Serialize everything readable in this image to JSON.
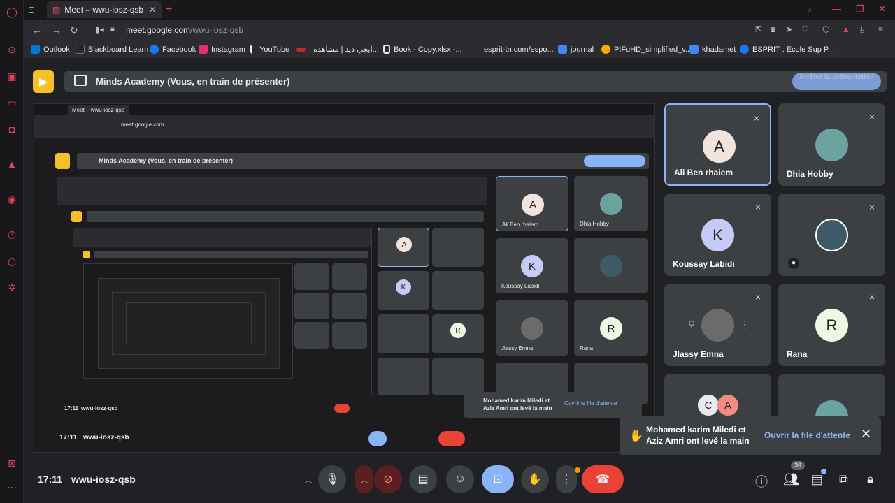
{
  "browser": {
    "tab_title": "Meet – wwu-iosz-qsb",
    "url_host": "meet.google.com",
    "url_path": "/wwu-iosz-qsb",
    "bookmarks": [
      {
        "label": "Outlook",
        "color": "#0078d4"
      },
      {
        "label": "Blackboard Learn",
        "color": "#262626"
      },
      {
        "label": "Facebook",
        "color": "#1877f2"
      },
      {
        "label": "Instagram",
        "color": "#e1306c"
      },
      {
        "label": "YouTube",
        "color": "#ff0000"
      },
      {
        "label": "ايجي ديد | مشاهدة ا...",
        "color": "#c62828"
      },
      {
        "label": "Book - Copy.xlsx -...",
        "color": "#444"
      },
      {
        "label": "esprit-tn.com/espo...",
        "color": "#555"
      },
      {
        "label": "journal",
        "color": "#4285f4"
      },
      {
        "label": "PIFuHD_simplified_v...",
        "color": "#f9ab00"
      },
      {
        "label": "khadamet",
        "color": "#4285f4"
      },
      {
        "label": "ESPRIT : École Sup P...",
        "color": "#1877f2"
      }
    ]
  },
  "meet": {
    "presenting_label": "Minds Academy (Vous, en train de présenter)",
    "stop_presenting_label": "Arrêter la présentation",
    "meeting_time": "17:11",
    "meeting_code": "wwu-iosz-qsb",
    "participant_count": "39",
    "participants": [
      {
        "name": "Ali Ben rhaiem",
        "initial": "A",
        "avatar_color": "#f1e4dc",
        "active": true
      },
      {
        "name": "Dhia Hobby",
        "initial": "",
        "avatar_color": "#6aa3a0",
        "active": false
      },
      {
        "name": "Koussay Labidi",
        "initial": "K",
        "avatar_color": "#c5cbf4",
        "active": false
      },
      {
        "name": "",
        "initial": "",
        "avatar_color": "#3e5a67",
        "active": false
      },
      {
        "name": "Jlassy Emna",
        "initial": "",
        "avatar_color": "#6b6b6b",
        "active": false
      },
      {
        "name": "Rana",
        "initial": "R",
        "avatar_color": "#eef7e4",
        "active": false
      },
      {
        "name": "",
        "initial": "C",
        "avatar_color": "#e8eaed",
        "active": false
      },
      {
        "name": "",
        "initial": "",
        "avatar_color": "#6aa3a0",
        "active": false
      }
    ],
    "extra_initial": "A",
    "toast": {
      "message_line1": "Mohamed karim Miledi et",
      "message_line2": "Aziz Amri ont levé la main",
      "action": "Ouvrir la file d'attente"
    }
  }
}
